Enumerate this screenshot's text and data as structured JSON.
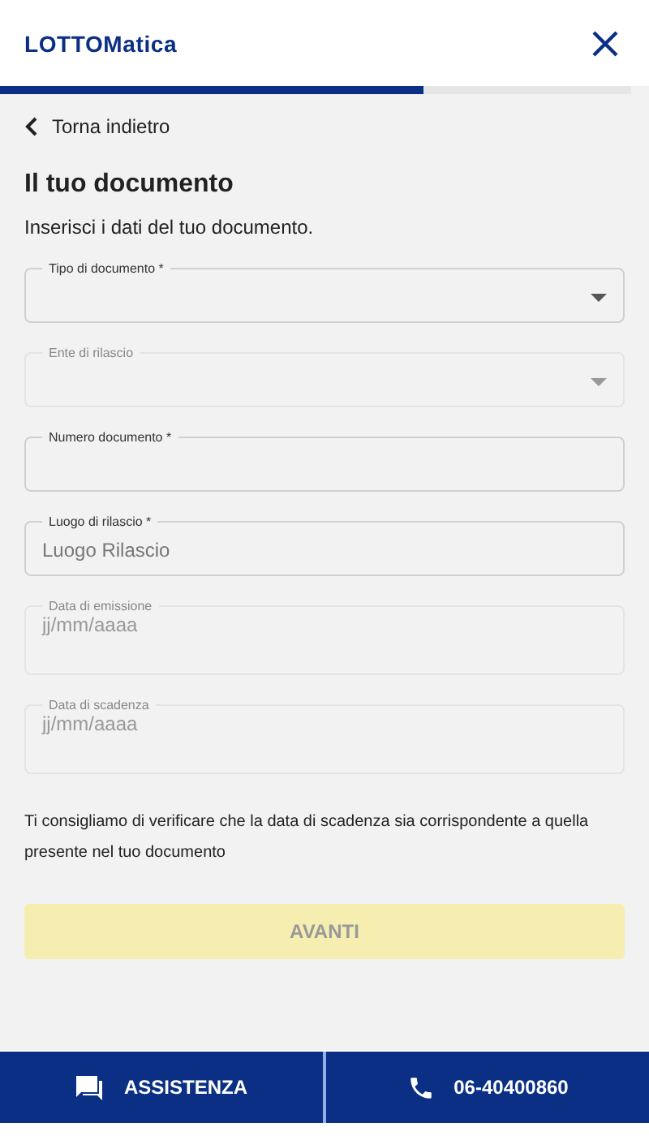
{
  "header": {
    "logo": "LOTTOMatica",
    "progress": {
      "level": 0.67
    }
  },
  "back_link": "Torna indietro",
  "title": "Il tuo documento",
  "subtitle": "Inserisci i dati del tuo documento.",
  "fields": [
    {
      "kind": "select",
      "label": "Tipo di documento *",
      "disabled": false
    },
    {
      "kind": "select",
      "label": "Ente di rilascio",
      "disabled": true
    },
    {
      "kind": "text",
      "label": "Numero documento *",
      "disabled": false
    },
    {
      "kind": "text",
      "label": "Luogo di rilascio *",
      "placeholder": "Luogo Rilascio",
      "disabled": false
    },
    {
      "kind": "date",
      "label": "Data di emissione",
      "placeholder": "jj/mm/aaaa",
      "disabled": true
    },
    {
      "kind": "date",
      "label": "Data di scadenza",
      "placeholder": "jj/mm/aaaa",
      "disabled": true
    }
  ],
  "note": "Ti consigliamo di verificare che la data di scadenza sia corrispondente a quella presente nel tuo documento",
  "next_button": {
    "label": "AVANTI",
    "disabled": true
  },
  "footer": [
    {
      "kind": "chat",
      "label": "ASSISTENZA"
    },
    {
      "kind": "phone",
      "label": "06-40400860"
    }
  ]
}
